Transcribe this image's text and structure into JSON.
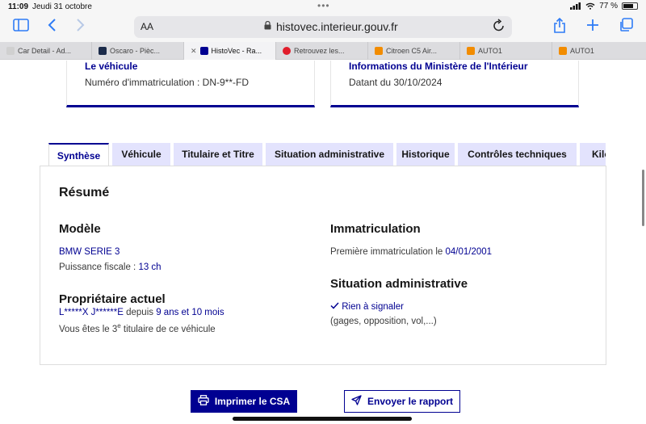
{
  "status": {
    "time": "11:09",
    "date": "Jeudi 31 octobre",
    "battery": "77 %",
    "battery_level": 0.77
  },
  "toolbar": {
    "text_size": "AA",
    "url": "histovec.interieur.gouv.fr"
  },
  "browser_tabs": [
    {
      "label": "Car Detail - Ad...",
      "favicon_color": "#d0d0d0"
    },
    {
      "label": "Oscaro - Pièc...",
      "favicon_color": "#1b2b4a"
    },
    {
      "label": "HistoVec - Ra...",
      "favicon_color": "#000091"
    },
    {
      "label": "Retrouvez les...",
      "favicon_color": "#e11d2b"
    },
    {
      "label": "Citroen C5 Air...",
      "favicon_color": "#f28c00"
    },
    {
      "label": "AUTO1",
      "favicon_color": "#f28c00"
    },
    {
      "label": "AUTO1",
      "favicon_color": "#f28c00"
    }
  ],
  "cards": {
    "vehicle": {
      "title": "Le véhicule",
      "line": "Numéro d'immatriculation : DN-9**-FD"
    },
    "ministry": {
      "title": "Informations du Ministère de l'Intérieur",
      "line": "Datant du 30/10/2024"
    }
  },
  "page_tabs": [
    "Synthèse",
    "Véhicule",
    "Titulaire et Titre",
    "Situation administrative",
    "Historique",
    "Contrôles techniques",
    "Kilo"
  ],
  "summary": {
    "heading": "Résumé",
    "model": {
      "heading": "Modèle",
      "name": "BMW SERIE 3",
      "power_label": "Puissance fiscale : ",
      "power_value": "13 ch"
    },
    "owner": {
      "heading": "Propriétaire actuel",
      "name": "L*****X J******E",
      "since_label": " depuis ",
      "since_value": "9 ans et 10 mois",
      "rank_prefix": "Vous êtes le ",
      "rank_number": "3",
      "rank_suffix": "e",
      "rank_end": " titulaire de ce véhicule"
    },
    "registration": {
      "heading": "Immatriculation",
      "label": "Première immatriculation le ",
      "date": "04/01/2001"
    },
    "admin": {
      "heading": "Situation administrative",
      "status": "Rien à signaler",
      "detail": "(gages, opposition, vol,...)"
    }
  },
  "actions": {
    "print": "Imprimer le CSA",
    "send": "Envoyer le rapport"
  },
  "colors": {
    "brand": "#000091",
    "tab_bg": "#e3e3fd"
  }
}
